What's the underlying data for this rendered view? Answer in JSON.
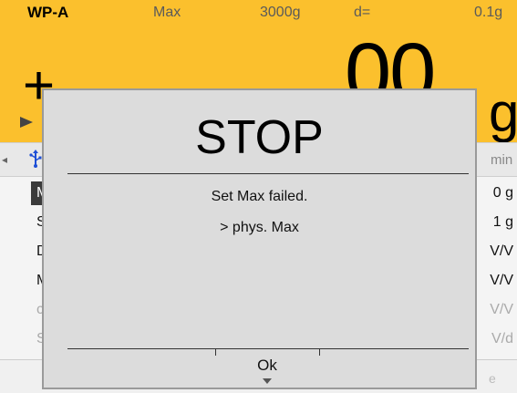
{
  "status_bar": {
    "model": "WP-A",
    "max_label": "Max",
    "max_value": "3000g",
    "d_label": "d=",
    "d_value": "0.1g"
  },
  "weigh_display": {
    "sign": "+",
    "value": "00",
    "unit": "g"
  },
  "toolbar": {
    "left_arrow": "◂",
    "usb_icon": "usb-icon",
    "right_text": "min"
  },
  "list": [
    {
      "left": "M",
      "right": "0 g",
      "selected": true
    },
    {
      "left": "S",
      "right": "1 g",
      "selected": false
    },
    {
      "left": "D",
      "right": "V/V",
      "selected": false
    },
    {
      "left": "M",
      "right": "V/V",
      "selected": false
    },
    {
      "left": "c",
      "right": "V/V",
      "dim": true
    },
    {
      "left": "S",
      "right": "V/d",
      "dim": true
    }
  ],
  "bottom_right": "e",
  "dialog": {
    "title": "STOP",
    "message_line1": "Set Max failed.",
    "message_line2": "> phys. Max",
    "ok_label": "Ok"
  },
  "colors": {
    "accent_yellow": "#fbc02d",
    "dialog_bg": "#dcdcdc",
    "usb_blue": "#1e4fd6"
  }
}
